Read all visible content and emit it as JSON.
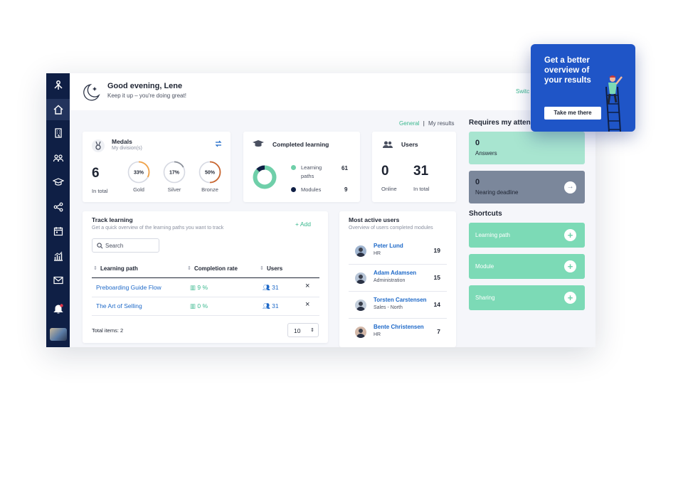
{
  "header": {
    "greeting": "Good evening, Lene",
    "subtitle": "Keep it up – you're doing great!",
    "switch_label": "Switc"
  },
  "filters": {
    "general": "General",
    "separator": "|",
    "my_results": "My results"
  },
  "medals": {
    "title": "Medals",
    "subtitle": "My division(s)",
    "total": "6",
    "total_label": "In total",
    "rings": [
      {
        "label": "Gold",
        "percent_text": "33%",
        "value": 33,
        "color": "#f0a34a"
      },
      {
        "label": "Silver",
        "percent_text": "17%",
        "value": 17,
        "color": "#8a8f99"
      },
      {
        "label": "Bronze",
        "percent_text": "50%",
        "value": 50,
        "color": "#c9652e"
      }
    ]
  },
  "completed": {
    "title": "Completed learning",
    "items": [
      {
        "label_line1": "Learning",
        "label_line2": "paths",
        "value": "61",
        "color": "#6fcfa9"
      },
      {
        "label_line1": "Modules",
        "value": "9",
        "color": "#0f1f45"
      }
    ],
    "donut": {
      "learning_paths": 61,
      "modules": 9
    }
  },
  "users": {
    "title": "Users",
    "online": "0",
    "online_label": "Online",
    "total": "31",
    "total_label": "In total"
  },
  "track": {
    "title": "Track learning",
    "subtitle": "Get a quick overview of the learning paths you want to track",
    "add_label": "+ Add",
    "search_placeholder": "Search",
    "columns": [
      "Learning path",
      "Completion rate",
      "Users"
    ],
    "rows": [
      {
        "path": "Preboarding Guide Flow",
        "rate": "9 %",
        "users": "31"
      },
      {
        "path": "The Art of Selling",
        "rate": "0 %",
        "users": "31"
      }
    ],
    "total_items": "Total items: 2",
    "page_size": "10"
  },
  "active_users": {
    "title": "Most active users",
    "subtitle": "Overview of users completed modules",
    "users": [
      {
        "name": "Peter Lund",
        "dept": "HR",
        "count": "19"
      },
      {
        "name": "Adam Adamsen",
        "dept": "Administration",
        "count": "15"
      },
      {
        "name": "Torsten Carstensen",
        "dept": "Sales - North",
        "count": "14"
      },
      {
        "name": "Bente Christensen",
        "dept": "HR",
        "count": "7"
      }
    ]
  },
  "attention": {
    "title": "Requires my atten",
    "answers_count": "0",
    "answers_label": "Answers",
    "deadline_count": "0",
    "deadline_label": "Nearing deadline"
  },
  "shortcuts": {
    "title": "Shortcuts",
    "items": [
      "Learning path",
      "Module",
      "Sharing"
    ]
  },
  "promo": {
    "text": "Get a better overview of your results",
    "button": "Take me there"
  }
}
